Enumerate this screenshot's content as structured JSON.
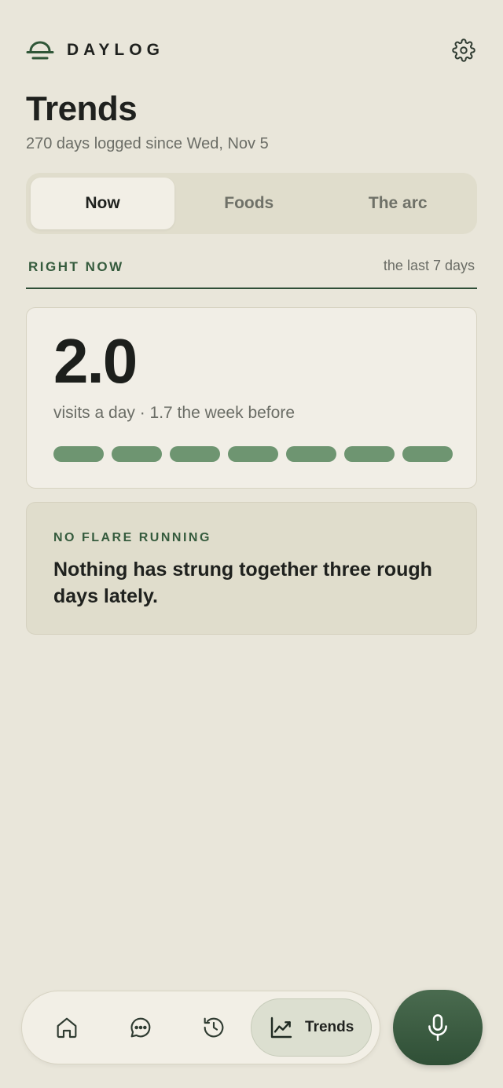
{
  "header": {
    "brand_name": "DAYLOG",
    "brand_icon": "bowl-dome-icon",
    "settings_icon": "gear-icon"
  },
  "page": {
    "title": "Trends",
    "subtitle": "270 days logged since Wed, Nov 5"
  },
  "tabs": [
    {
      "label": "Now",
      "active": true
    },
    {
      "label": "Foods",
      "active": false
    },
    {
      "label": "The arc",
      "active": false
    }
  ],
  "section": {
    "label": "RIGHT NOW",
    "range": "the last 7 days"
  },
  "stat": {
    "value": "2.0",
    "caption": "visits a day · 1.7 the week before",
    "day_pills": 7
  },
  "flare": {
    "label": "NO FLARE RUNNING",
    "text": "Nothing has strung together three rough days lately."
  },
  "nav": {
    "items": [
      {
        "icon": "home-icon",
        "label": ""
      },
      {
        "icon": "chat-bubble-icon",
        "label": ""
      },
      {
        "icon": "history-icon",
        "label": ""
      },
      {
        "icon": "trend-chart-icon",
        "label": "Trends",
        "active": true
      }
    ],
    "mic_icon": "microphone-icon"
  },
  "colors": {
    "background": "#e9e6da",
    "accent": "#355b3d",
    "pill": "#6e9571",
    "mic_button": "#3d5e43"
  }
}
